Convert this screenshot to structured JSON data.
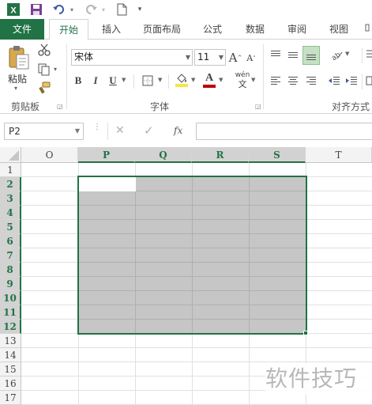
{
  "qat": {
    "save_icon": "save-icon",
    "undo_icon": "undo-icon",
    "redo_icon": "redo-icon",
    "new_icon": "new-document-icon",
    "customize": "▾"
  },
  "tabs": {
    "file": "文件",
    "items": [
      "开始",
      "插入",
      "页面布局",
      "公式",
      "数据",
      "审阅",
      "视图"
    ],
    "active": "开始"
  },
  "ribbon": {
    "clipboard": {
      "paste_label": "粘贴",
      "group_label": "剪贴板"
    },
    "font": {
      "font_name": "宋体",
      "font_size": "11",
      "grow": "A",
      "shrink": "A",
      "bold": "B",
      "italic": "I",
      "underline": "U",
      "phonetic_top": "wén",
      "phonetic_bottom": "文",
      "font_color_letter": "A",
      "group_label": "字体",
      "fill_color": "#f5e642",
      "font_color": "#c00000"
    },
    "alignment": {
      "group_label": "对齐方式"
    }
  },
  "formula_bar": {
    "name_box": "P2",
    "cancel_symbol": "✕",
    "enter_symbol": "✓",
    "fx_label": "fx",
    "formula_value": ""
  },
  "grid": {
    "columns": [
      "O",
      "P",
      "Q",
      "R",
      "S",
      "T"
    ],
    "selected_columns": [
      "P",
      "Q",
      "R",
      "S"
    ],
    "rows": [
      "1",
      "2",
      "3",
      "4",
      "5",
      "6",
      "7",
      "8",
      "9",
      "10",
      "11",
      "12",
      "13",
      "14",
      "15",
      "16",
      "17"
    ],
    "selected_rows": [
      "2",
      "3",
      "4",
      "5",
      "6",
      "7",
      "8",
      "9",
      "10",
      "11",
      "12"
    ],
    "active_cell": "P2",
    "accent_color": "#217346"
  },
  "watermark": "软件技巧"
}
